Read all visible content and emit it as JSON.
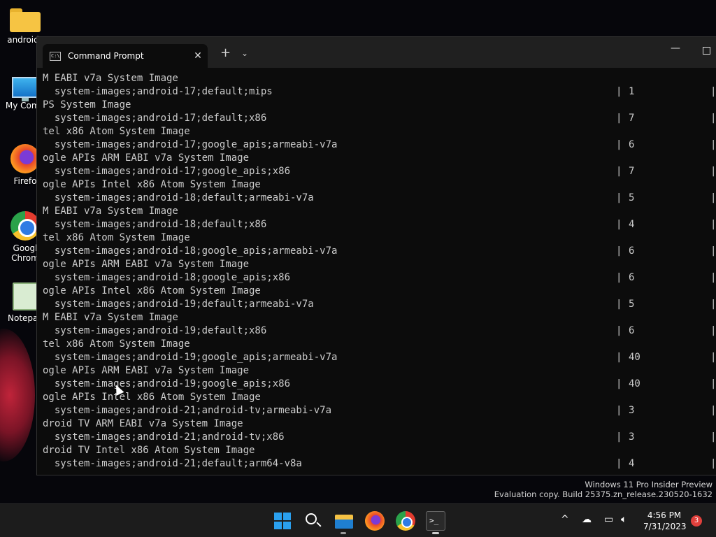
{
  "desktop": {
    "icons": [
      {
        "label": "android_",
        "icon": "folder-icon"
      },
      {
        "label": "My Comp",
        "icon": "computer-icon"
      },
      {
        "label": "Firefo",
        "icon": "firefox-icon"
      },
      {
        "label": "Googl",
        "label2": "Chrom",
        "icon": "chrome-icon"
      },
      {
        "label": "Notepac",
        "icon": "notepad-icon"
      }
    ]
  },
  "window": {
    "tab_title": "Command Prompt",
    "tab_icon_text": "C:\\",
    "close_glyph": "✕",
    "new_tab_glyph": "+",
    "dropdown_glyph": "⌄",
    "minimize_glyph": "—"
  },
  "console": {
    "pipe": "|",
    "lines": [
      {
        "text": "M EABI v7a System Image"
      },
      {
        "pkg": "  system-images;android-17;default;mips",
        "ver": "1"
      },
      {
        "text": "PS System Image"
      },
      {
        "pkg": "  system-images;android-17;default;x86",
        "ver": "7"
      },
      {
        "text": "tel x86 Atom System Image"
      },
      {
        "pkg": "  system-images;android-17;google_apis;armeabi-v7a",
        "ver": "6"
      },
      {
        "text": "ogle APIs ARM EABI v7a System Image"
      },
      {
        "pkg": "  system-images;android-17;google_apis;x86",
        "ver": "7"
      },
      {
        "text": "ogle APIs Intel x86 Atom System Image"
      },
      {
        "pkg": "  system-images;android-18;default;armeabi-v7a",
        "ver": "5"
      },
      {
        "text": "M EABI v7a System Image"
      },
      {
        "pkg": "  system-images;android-18;default;x86",
        "ver": "4"
      },
      {
        "text": "tel x86 Atom System Image"
      },
      {
        "pkg": "  system-images;android-18;google_apis;armeabi-v7a",
        "ver": "6"
      },
      {
        "text": "ogle APIs ARM EABI v7a System Image"
      },
      {
        "pkg": "  system-images;android-18;google_apis;x86",
        "ver": "6"
      },
      {
        "text": "ogle APIs Intel x86 Atom System Image"
      },
      {
        "pkg": "  system-images;android-19;default;armeabi-v7a",
        "ver": "5"
      },
      {
        "text": "M EABI v7a System Image"
      },
      {
        "pkg": "  system-images;android-19;default;x86",
        "ver": "6"
      },
      {
        "text": "tel x86 Atom System Image"
      },
      {
        "pkg": "  system-images;android-19;google_apis;armeabi-v7a",
        "ver": "40"
      },
      {
        "text": "ogle APIs ARM EABI v7a System Image"
      },
      {
        "pkg": "  system-images;android-19;google_apis;x86",
        "ver": "40"
      },
      {
        "text": "ogle APIs Intel x86 Atom System Image"
      },
      {
        "pkg": "  system-images;android-21;android-tv;armeabi-v7a",
        "ver": "3"
      },
      {
        "text": "droid TV ARM EABI v7a System Image"
      },
      {
        "pkg": "  system-images;android-21;android-tv;x86",
        "ver": "3"
      },
      {
        "text": "droid TV Intel x86 Atom System Image"
      },
      {
        "pkg": "  system-images;android-21;default;arm64-v8a",
        "ver": "4"
      }
    ]
  },
  "watermark": {
    "line1": "Windows 11 Pro Insider Preview",
    "line2": "Evaluation copy. Build 25375.zn_release.230520-1632"
  },
  "taskbar": {
    "terminal_glyph": ">_",
    "tray_chevron": "^",
    "clock_time": "4:56 PM",
    "clock_date": "7/31/2023",
    "notification_count": "3"
  }
}
